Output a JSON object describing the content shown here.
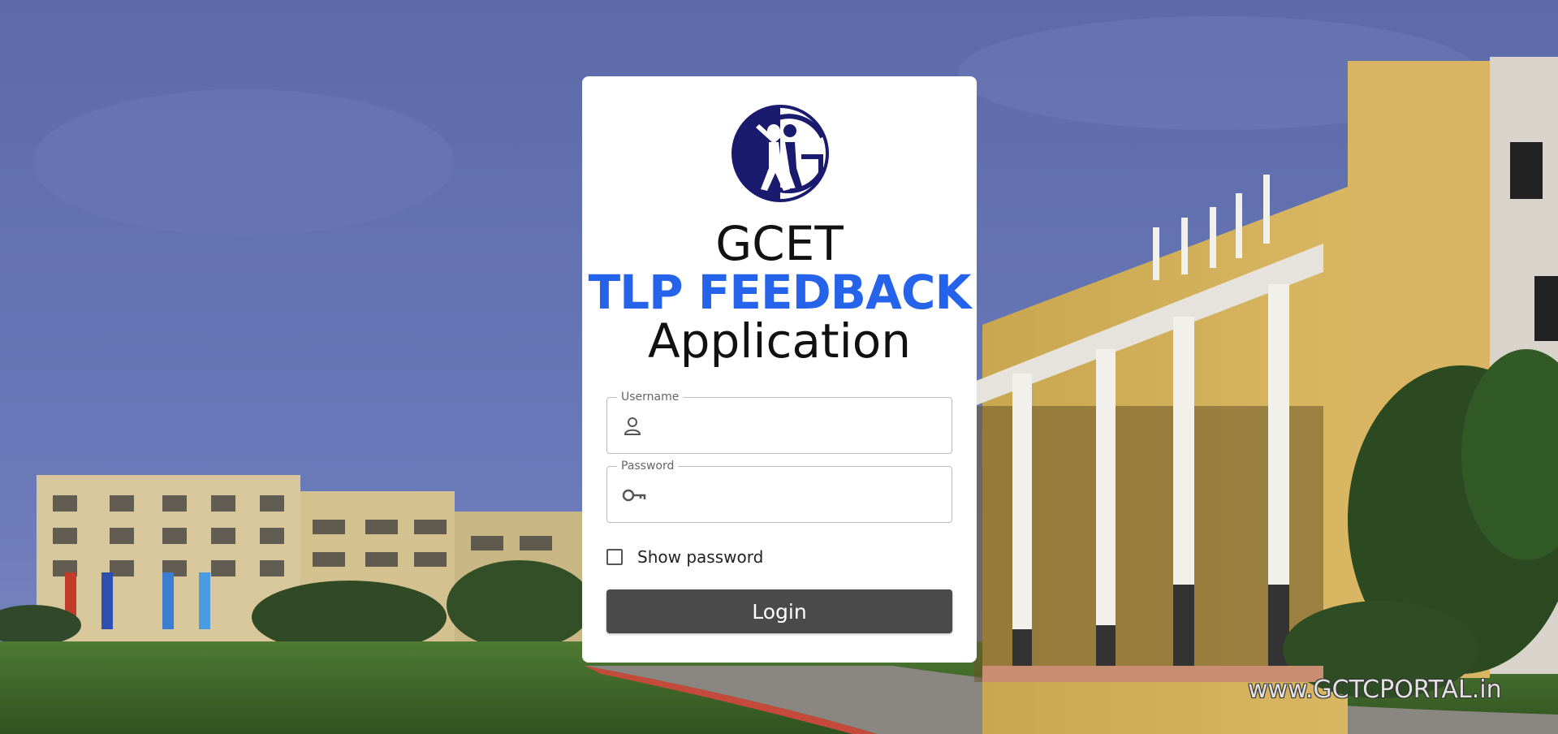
{
  "background": {
    "watermark": "www.GCTCPORTAL.in"
  },
  "logo": {
    "icon": "gcet-logo-icon"
  },
  "title": {
    "line1": "GCET",
    "line2": "TLP FEEDBACK",
    "line3": "Application"
  },
  "username": {
    "label": "Username",
    "value": "",
    "icon": "person-icon"
  },
  "password": {
    "label": "Password",
    "value": "",
    "icon": "key-icon"
  },
  "show_password": {
    "label": "Show password",
    "checked": false
  },
  "login": {
    "label": "Login"
  },
  "colors": {
    "accent": "#2563eb",
    "logo": "#1a1a6e",
    "button": "#4a4a4a"
  }
}
